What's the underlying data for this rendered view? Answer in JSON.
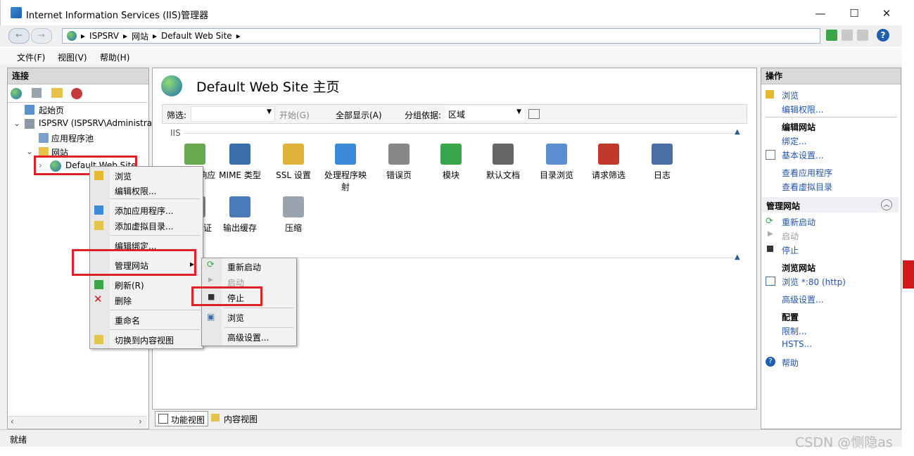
{
  "window": {
    "title": "Internet Information Services (IIS)管理器",
    "minimize": "—",
    "maximize": "☐",
    "close": "✕"
  },
  "address": {
    "crumbs": [
      "ISPSRV",
      "网站",
      "Default Web Site"
    ],
    "sep": "▸"
  },
  "menu": [
    "文件(F)",
    "视图(V)",
    "帮助(H)"
  ],
  "left_panel": {
    "header": "连接",
    "tree": {
      "start_page": "起始页",
      "server": "ISPSRV (ISPSRV\\Administra",
      "app_pools": "应用程序池",
      "sites": "网站",
      "default_site": "Default Web Site"
    }
  },
  "center": {
    "page_title": "Default Web Site 主页",
    "filter_label": "筛选:",
    "go_button": "开始(G)",
    "show_all": "全部显示(A)",
    "group_label": "分组依据:",
    "group_value": "区域",
    "section": "IIS",
    "features_row1": [
      "HTTP 响应标",
      "MIME 类型",
      "SSL 设置",
      "处理程序映射",
      "错误页",
      "模块",
      "默认文档",
      "目录浏览",
      "请求筛选",
      "日志"
    ],
    "features_row2": [
      "身份验证",
      "输出缓存",
      "压缩"
    ],
    "bottom_tabs": [
      "功能视图",
      "内容视图"
    ]
  },
  "right_panel": {
    "header": "操作",
    "browse": "浏览",
    "edit_permissions": "编辑权限...",
    "edit_site_title": "编辑网站",
    "bindings": "绑定...",
    "basic_settings": "基本设置...",
    "view_apps": "查看应用程序",
    "view_vdirs": "查看虚拟目录",
    "manage_site_title": "管理网站",
    "restart": "重新启动",
    "start": "启动",
    "stop": "停止",
    "browse_site_title": "浏览网站",
    "browse_80": "浏览 *:80 (http)",
    "advanced": "高级设置...",
    "config_title": "配置",
    "limits": "限制...",
    "hsts": "HSTS...",
    "help": "帮助"
  },
  "context_menu": {
    "items": [
      "浏览",
      "编辑权限...",
      "添加应用程序...",
      "添加虚拟目录...",
      "编辑绑定...",
      "管理网站",
      "刷新(R)",
      "删除",
      "重命名",
      "切换到内容视图"
    ]
  },
  "submenu": {
    "items": [
      "重新启动",
      "启动",
      "停止",
      "浏览",
      "高级设置..."
    ]
  },
  "status": "就绪",
  "watermark": "CSDN @恻隐as",
  "colors": {
    "highlight_red": "#e0212a",
    "link_blue": "#2255aa"
  }
}
